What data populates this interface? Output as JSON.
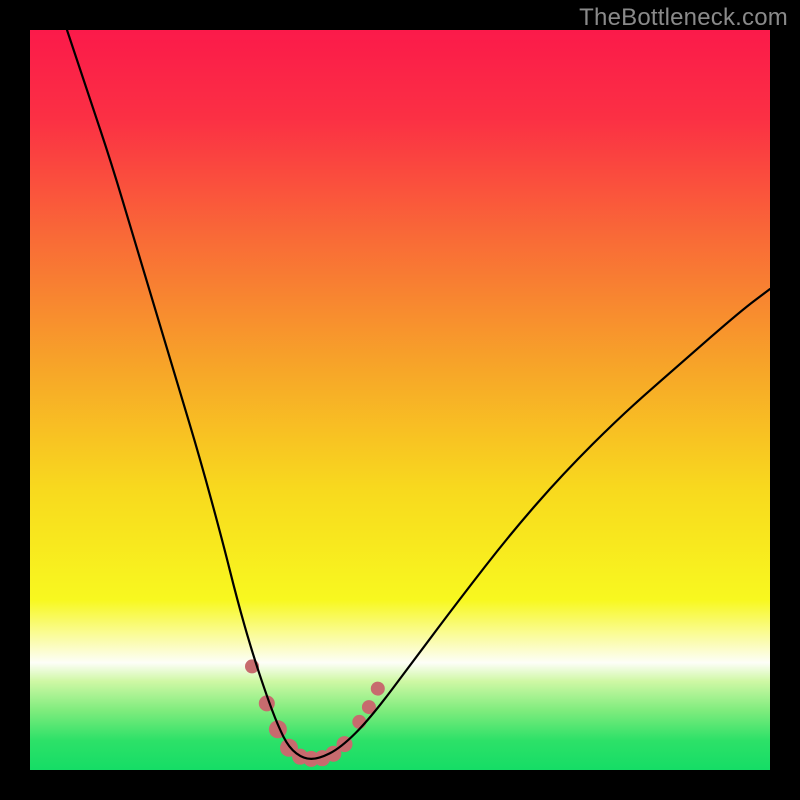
{
  "watermark": "TheBottleneck.com",
  "chart_data": {
    "type": "line",
    "title": "",
    "xlabel": "",
    "ylabel": "",
    "xlim": [
      0,
      100
    ],
    "ylim": [
      0,
      100
    ],
    "series": [
      {
        "name": "bottleneck-curve",
        "x": [
          5,
          8,
          11,
          14,
          17,
          20,
          23,
          26,
          28,
          30,
          32,
          33.5,
          35,
          37,
          39,
          42,
          46,
          52,
          58,
          65,
          72,
          80,
          88,
          96,
          100
        ],
        "y": [
          100,
          91,
          82,
          72,
          62,
          52,
          42,
          31,
          23,
          16,
          10,
          6,
          3,
          1.5,
          1.5,
          3,
          7,
          15,
          23,
          32,
          40,
          48,
          55,
          62,
          65
        ]
      }
    ],
    "markers": {
      "name": "highlight-points",
      "color": "#c76b6e",
      "x": [
        30,
        32,
        33.5,
        35,
        36.5,
        38,
        39.5,
        41,
        42.5,
        44.5,
        45.8,
        47
      ],
      "y": [
        14,
        9,
        5.5,
        3,
        1.8,
        1.5,
        1.6,
        2.2,
        3.5,
        6.5,
        8.5,
        11
      ],
      "radius": [
        7,
        8,
        9,
        9,
        8,
        8,
        8,
        8,
        8,
        7,
        7,
        7
      ]
    },
    "gradient_stops": [
      {
        "offset": 0.0,
        "color": "#fb1a4a"
      },
      {
        "offset": 0.12,
        "color": "#fb3044"
      },
      {
        "offset": 0.28,
        "color": "#f96a37"
      },
      {
        "offset": 0.45,
        "color": "#f7a329"
      },
      {
        "offset": 0.62,
        "color": "#f8d91e"
      },
      {
        "offset": 0.77,
        "color": "#f8f81f"
      },
      {
        "offset": 0.82,
        "color": "#fafca0"
      },
      {
        "offset": 0.855,
        "color": "#fdfef8"
      },
      {
        "offset": 0.88,
        "color": "#cff8a5"
      },
      {
        "offset": 0.92,
        "color": "#7eec7d"
      },
      {
        "offset": 0.96,
        "color": "#2de168"
      },
      {
        "offset": 1.0,
        "color": "#15dd66"
      }
    ]
  }
}
